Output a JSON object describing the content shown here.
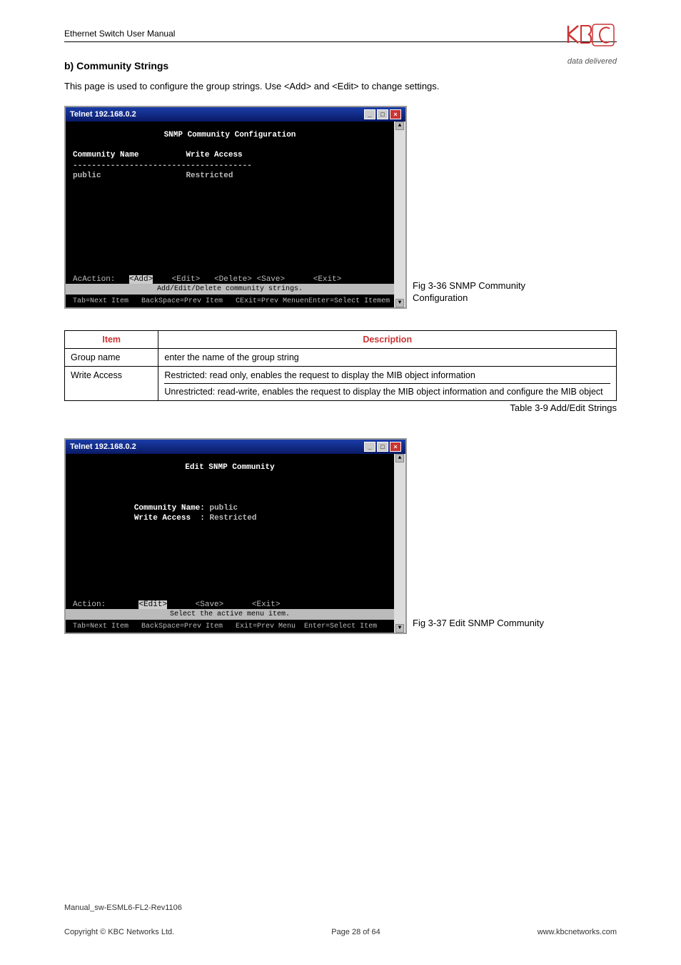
{
  "logo": {
    "tagline": "data delivered"
  },
  "header": {
    "title": "Ethernet Switch User Manual"
  },
  "section": {
    "heading": "b)  Community Strings",
    "intro": "This page is used to configure the group strings. Use <Add> and <Edit> to change settings."
  },
  "telnet1": {
    "title": "Telnet 192.168.0.2",
    "screen_title": "SNMP Community Configuration",
    "col1": "Community Name",
    "col2": "Write Access",
    "dashes": "--------------------------------------",
    "row1_name": "public",
    "row1_access": "Restricted",
    "action_label": "AcAction:",
    "add": "<Add>",
    "edit": "<Edit>",
    "delete": "<Delete>",
    "save": "<Save>",
    "exit": "<Exit>",
    "help": "Add/Edit/Delete community strings.",
    "nav": "Tab=Next Item   BackSpace=Prev Item   CExit=Prev MenuenEnter=Select Itemem"
  },
  "caption1": {
    "line1": "Fig 3-36 SNMP Community",
    "line2": "Configuration"
  },
  "table": {
    "h_item": "Item",
    "h_desc": "Description",
    "r1_item": "Group name",
    "r1_desc": "enter the name of the group string",
    "r2_item": "Write Access",
    "r2_desc_a": "Restricted: read only, enables the request to display the MIB object information",
    "r2_desc_b": "Unrestricted: read-write, enables the request to display the MIB object information and configure the MIB object",
    "caption": "Table 3-9 Add/Edit Strings"
  },
  "telnet2": {
    "title": "Telnet 192.168.0.2",
    "screen_title": "Edit SNMP Community",
    "name_label": "Community Name:",
    "name_value": "public",
    "access_label": "Write Access  :",
    "access_value": "Restricted",
    "action_label": "Action:",
    "edit": "<Edit>",
    "save": "<Save>",
    "exit": "<Exit>",
    "help": "Select the active menu item.",
    "nav": "Tab=Next Item   BackSpace=Prev Item   Exit=Prev Menu  Enter=Select Item"
  },
  "caption2": {
    "text": "Fig 3-37 Edit SNMP Community"
  },
  "footer": {
    "manual": "Manual_sw-ESML6-FL2-Rev1106",
    "left": "Copyright © KBC Networks Ltd.",
    "center": "Page 28 of 64",
    "right": "www.kbcnetworks.com"
  }
}
